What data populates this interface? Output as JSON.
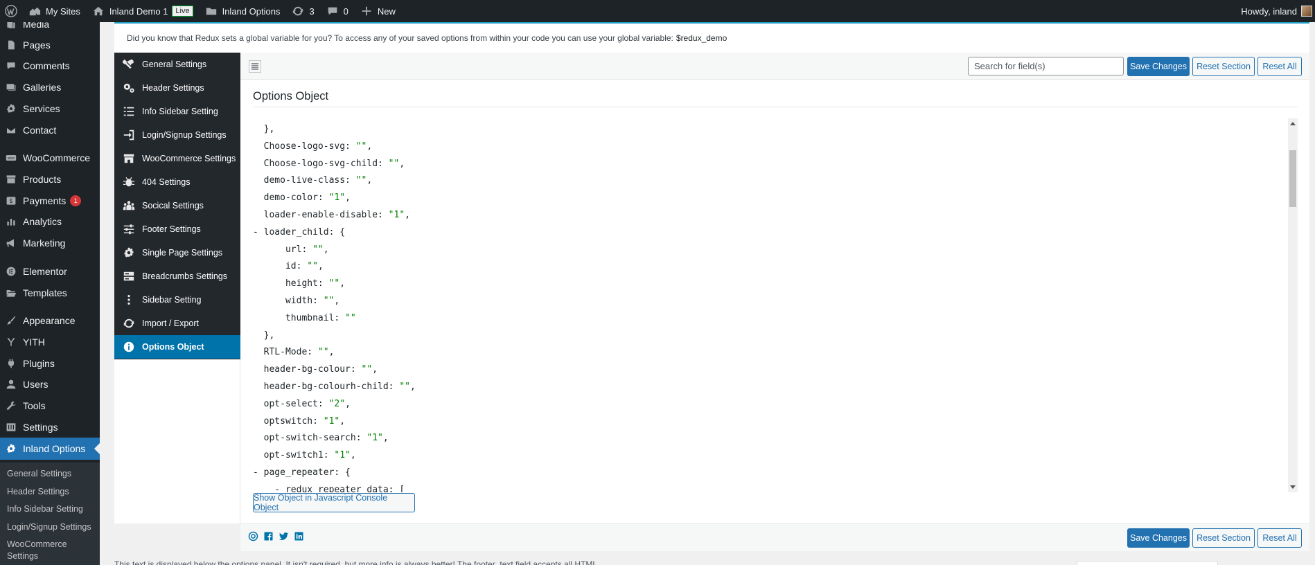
{
  "admin_bar": {
    "my_sites": "My Sites",
    "site_name": "Inland Demo 1",
    "live_badge": "Live",
    "options_link": "Inland Options",
    "updates_count": "3",
    "comments_count": "0",
    "new_label": "New",
    "howdy": "Howdy, inland"
  },
  "admin_menu": {
    "items": [
      "Media",
      "Pages",
      "Comments",
      "Galleries",
      "Services",
      "Contact",
      "WooCommerce",
      "Products",
      "Payments",
      "Analytics",
      "Marketing",
      "Elementor",
      "Templates",
      "Appearance",
      "YITH",
      "Plugins",
      "Users",
      "Tools",
      "Settings",
      "Inland Options"
    ],
    "payments_badge": "1",
    "submenu": [
      "General Settings",
      "Header Settings",
      "Info Sidebar Setting",
      "Login/Signup Settings",
      "WooCommerce Settings"
    ]
  },
  "notice": {
    "text": "Did you know that Redux sets a global variable for you? To access any of your saved options from within your code you can use your global variable:",
    "variable": "$redux_demo"
  },
  "redux_sidebar": {
    "items": [
      "General Settings",
      "Header Settings",
      "Info Sidebar Setting",
      "Login/Signup Settings",
      "WooCommerce Settings",
      "404 Settings",
      "Socical Settings",
      "Footer Settings",
      "Single Page Settings",
      "Breadcrumbs Settings",
      "Sidebar Setting",
      "Import / Export",
      "Options Object"
    ]
  },
  "toolbar": {
    "search_placeholder": "Search for field(s)",
    "save_label": "Save Changes",
    "reset_section_label": "Reset Section",
    "reset_all_label": "Reset All"
  },
  "section": {
    "title": "Options Object",
    "show_object_label": "Show Object in Javascript Console Object"
  },
  "code_lines": [
    {
      "prefix": "  },",
      "key": "",
      "value": "",
      "suffix": ""
    },
    {
      "prefix": "  ",
      "key": "Choose-logo-svg: ",
      "value": "\"\"",
      "suffix": ","
    },
    {
      "prefix": "  ",
      "key": "Choose-logo-svg-child: ",
      "value": "\"\"",
      "suffix": ","
    },
    {
      "prefix": "  ",
      "key": "demo-live-class: ",
      "value": "\"\"",
      "suffix": ","
    },
    {
      "prefix": "  ",
      "key": "demo-color: ",
      "value": "\"1\"",
      "suffix": ","
    },
    {
      "prefix": "  ",
      "key": "loader-enable-disable: ",
      "value": "\"1\"",
      "suffix": ","
    },
    {
      "prefix": "- ",
      "key": "loader_child: {",
      "value": "",
      "suffix": ""
    },
    {
      "prefix": "      ",
      "key": "url: ",
      "value": "\"\"",
      "suffix": ","
    },
    {
      "prefix": "      ",
      "key": "id: ",
      "value": "\"\"",
      "suffix": ","
    },
    {
      "prefix": "      ",
      "key": "height: ",
      "value": "\"\"",
      "suffix": ","
    },
    {
      "prefix": "      ",
      "key": "width: ",
      "value": "\"\"",
      "suffix": ","
    },
    {
      "prefix": "      ",
      "key": "thumbnail: ",
      "value": "\"\"",
      "suffix": ""
    },
    {
      "prefix": "  },",
      "key": "",
      "value": "",
      "suffix": ""
    },
    {
      "prefix": "  ",
      "key": "RTL-Mode: ",
      "value": "\"\"",
      "suffix": ","
    },
    {
      "prefix": "  ",
      "key": "header-bg-colour: ",
      "value": "\"\"",
      "suffix": ","
    },
    {
      "prefix": "  ",
      "key": "header-bg-colourh-child: ",
      "value": "\"\"",
      "suffix": ","
    },
    {
      "prefix": "  ",
      "key": "opt-select: ",
      "value": "\"2\"",
      "suffix": ","
    },
    {
      "prefix": "  ",
      "key": "optswitch: ",
      "value": "\"1\"",
      "suffix": ","
    },
    {
      "prefix": "  ",
      "key": "opt-switch-search: ",
      "value": "\"1\"",
      "suffix": ","
    },
    {
      "prefix": "  ",
      "key": "opt-switch1: ",
      "value": "\"1\"",
      "suffix": ","
    },
    {
      "prefix": "- ",
      "key": "page_repeater: {",
      "value": "",
      "suffix": ""
    },
    {
      "prefix": "    - ",
      "key": "redux_repeater_data: [",
      "value": "",
      "suffix": ""
    },
    {
      "prefix": "        ",
      "key": "{",
      "value": "",
      "suffix": ""
    }
  ],
  "footer": {
    "text": "This text is displayed below the options panel. It isn't required, but more info is always better! The footer_text field accepts all HTML."
  },
  "colors": {
    "admin_dark": "#1d2327",
    "accent_blue": "#2271b1",
    "redux_active": "#0073aa",
    "code_value": "#008000"
  }
}
